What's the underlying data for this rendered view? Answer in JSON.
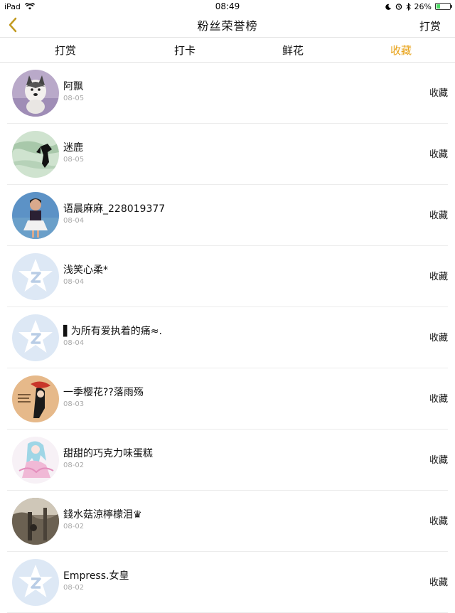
{
  "status_bar": {
    "device": "iPad",
    "time": "08:49",
    "battery": "26%",
    "battery_level": 0.26
  },
  "nav": {
    "title": "粉丝荣誉榜",
    "right_label": "打赏",
    "back_icon": "chevron-left-icon"
  },
  "tabs": [
    {
      "label": "打赏",
      "active": false
    },
    {
      "label": "打卡",
      "active": false
    },
    {
      "label": "鲜花",
      "active": false
    },
    {
      "label": "收藏",
      "active": true
    }
  ],
  "accent_color": "#e8a217",
  "items": [
    {
      "name": "阿飘",
      "date": "08-05",
      "action": "收藏",
      "avatar": "husky-dog-photo"
    },
    {
      "name": "迷鹿",
      "date": "08-05",
      "action": "收藏",
      "avatar": "ink-silhouette-photo"
    },
    {
      "name": "语晨麻麻_228019377",
      "date": "08-04",
      "action": "收藏",
      "avatar": "girl-photo"
    },
    {
      "name": "浅笑心柔*",
      "date": "08-04",
      "action": "收藏",
      "avatar": "default-z-avatar"
    },
    {
      "name": "▌为所有爱执着的痛≈.",
      "date": "08-04",
      "action": "收藏",
      "avatar": "default-z-avatar"
    },
    {
      "name": "一季樱花??落雨殇",
      "date": "08-03",
      "action": "收藏",
      "avatar": "red-hat-girl-photo"
    },
    {
      "name": "甜甜的巧克力味蛋糕",
      "date": "08-02",
      "action": "收藏",
      "avatar": "anime-girl-illustration"
    },
    {
      "name": "錢水菇涼檸檬泪♛",
      "date": "08-02",
      "action": "收藏",
      "avatar": "forest-photo"
    },
    {
      "name": "Empress.女皇",
      "date": "08-02",
      "action": "收藏",
      "avatar": "default-z-avatar"
    }
  ]
}
